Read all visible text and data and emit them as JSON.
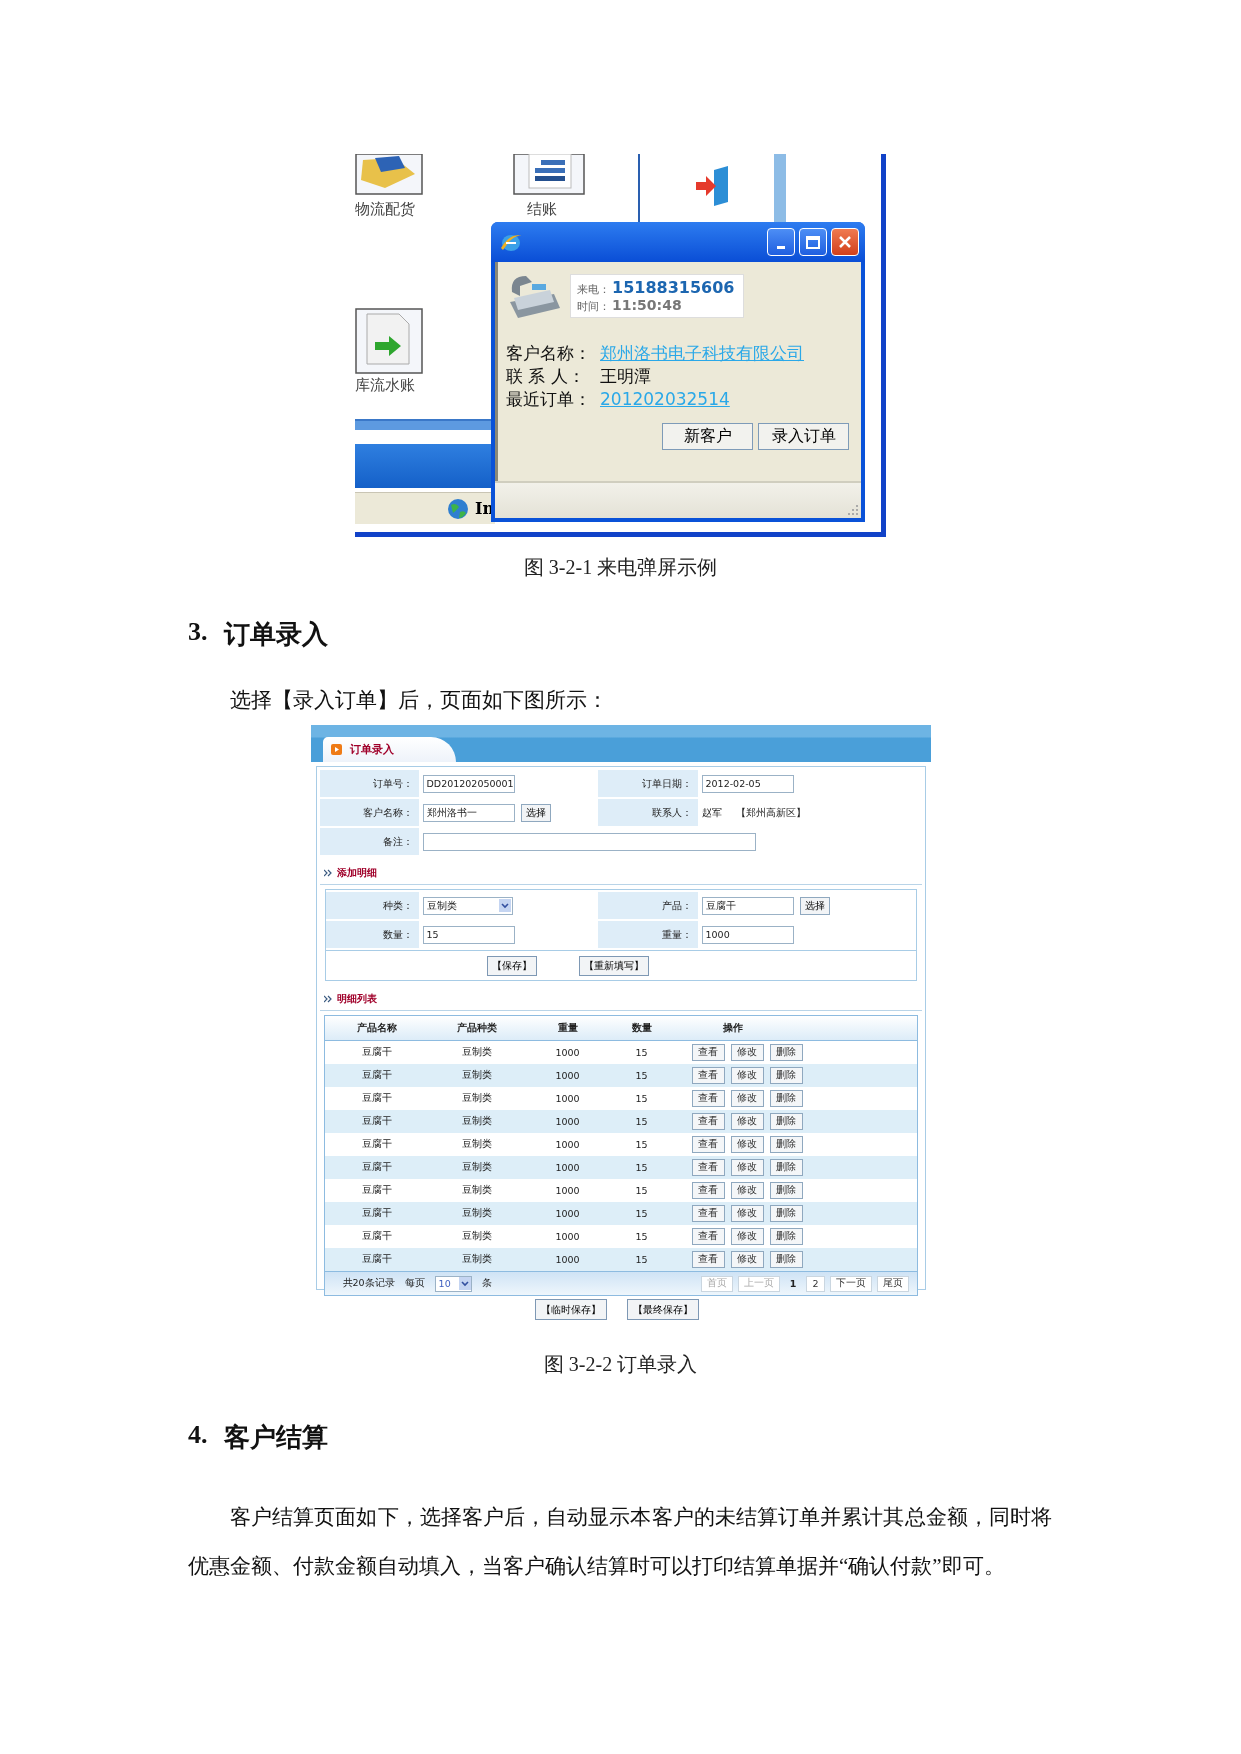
{
  "call_screenshot": {
    "desktop_icons": [
      {
        "kind": "folder",
        "label": "物流配货"
      },
      {
        "kind": "chart",
        "label": "结账"
      },
      {
        "kind": "document",
        "label": "库流水账"
      }
    ],
    "taskbar_item": "In",
    "popup": {
      "caller_label": "来电：",
      "caller_number": "15188315606",
      "time_label": "时间：",
      "time": "11:50:48",
      "fields": [
        {
          "label": "客户名称：",
          "value": "郑州洛书电子科技有限公司",
          "link": true
        },
        {
          "label": "联 系 人：",
          "value": "王明潭",
          "link": false
        },
        {
          "label": "最近订单：",
          "value": "201202032514",
          "link": true
        }
      ],
      "buttons": [
        "新客户",
        "录入订单"
      ]
    }
  },
  "caption_1": "图 3-2-1  来电弹屏示例",
  "section_3": {
    "number": "3.",
    "title": "订单录入"
  },
  "paragraph_1": "选择【录入订单】后，页面如下图所示：",
  "order_screenshot": {
    "tab": "订单录入",
    "header_rows": [
      [
        {
          "label": "订单号：",
          "kind": "input",
          "value": "DD201202050001"
        },
        {
          "label": "订单日期：",
          "kind": "input",
          "value": "2012-02-05"
        }
      ],
      [
        {
          "label": "客户名称：",
          "kind": "input_select",
          "value": "郑州洛书一",
          "button": "选择"
        },
        {
          "label": "联系人：",
          "kind": "text",
          "value": "赵军",
          "extra": "【郑州高新区】"
        }
      ],
      [
        {
          "label": "备注：",
          "kind": "wide_input"
        }
      ]
    ],
    "detail_title": "添加明细",
    "detail_rows": [
      [
        {
          "label": "种类：",
          "kind": "select",
          "value": "豆制类"
        },
        {
          "label": "产品：",
          "kind": "input_select",
          "value": "豆腐干",
          "button": "选择"
        }
      ],
      [
        {
          "label": "数量：",
          "kind": "input",
          "value": "15"
        },
        {
          "label": "重量：",
          "kind": "input",
          "value": "1000"
        }
      ]
    ],
    "detail_buttons": [
      "【保存】",
      "【重新填写】"
    ],
    "list_title": "明细列表",
    "table": {
      "columns": [
        "产品名称",
        "产品种类",
        "重量",
        "数量",
        "操作"
      ],
      "rows": [
        {
          "cells": [
            "豆腐干",
            "豆制类",
            "1000",
            "15"
          ],
          "actions": [
            "查看",
            "修改",
            "删除"
          ]
        },
        {
          "cells": [
            "豆腐干",
            "豆制类",
            "1000",
            "15"
          ],
          "actions": [
            "查看",
            "修改",
            "删除"
          ]
        },
        {
          "cells": [
            "豆腐干",
            "豆制类",
            "1000",
            "15"
          ],
          "actions": [
            "查看",
            "修改",
            "删除"
          ]
        },
        {
          "cells": [
            "豆腐干",
            "豆制类",
            "1000",
            "15"
          ],
          "actions": [
            "查看",
            "修改",
            "删除"
          ]
        },
        {
          "cells": [
            "豆腐干",
            "豆制类",
            "1000",
            "15"
          ],
          "actions": [
            "查看",
            "修改",
            "删除"
          ]
        },
        {
          "cells": [
            "豆腐干",
            "豆制类",
            "1000",
            "15"
          ],
          "actions": [
            "查看",
            "修改",
            "删除"
          ]
        },
        {
          "cells": [
            "豆腐干",
            "豆制类",
            "1000",
            "15"
          ],
          "actions": [
            "查看",
            "修改",
            "删除"
          ]
        },
        {
          "cells": [
            "豆腐干",
            "豆制类",
            "1000",
            "15"
          ],
          "actions": [
            "查看",
            "修改",
            "删除"
          ]
        },
        {
          "cells": [
            "豆腐干",
            "豆制类",
            "1000",
            "15"
          ],
          "actions": [
            "查看",
            "修改",
            "删除"
          ]
        },
        {
          "cells": [
            "豆腐干",
            "豆制类",
            "1000",
            "15"
          ],
          "actions": [
            "查看",
            "修改",
            "删除"
          ]
        }
      ]
    },
    "pager": {
      "summary": "共20条记录",
      "per_page_label": "每页",
      "per_page": "10",
      "per_page_unit": "条",
      "links": [
        {
          "label": "首页",
          "kind": "disabled"
        },
        {
          "label": "上一页",
          "kind": "disabled"
        },
        {
          "label": "1",
          "kind": "current"
        },
        {
          "label": "2",
          "kind": "page"
        },
        {
          "label": "下一页",
          "kind": "nav"
        },
        {
          "label": "尾页",
          "kind": "nav"
        }
      ]
    },
    "footer_buttons": [
      "【临时保存】",
      "【最终保存】"
    ]
  },
  "caption_2": "图 3-2-2  订单录入",
  "section_4": {
    "number": "4.",
    "title": "客户结算"
  },
  "paragraph_2": "客户结算页面如下，选择客户后，自动显示本客户的未结算订单并累计其总金额，同时将优惠金额、付款金额自动填入，当客户确认结算时可以打印结算单据并“确认付款”即可。"
}
